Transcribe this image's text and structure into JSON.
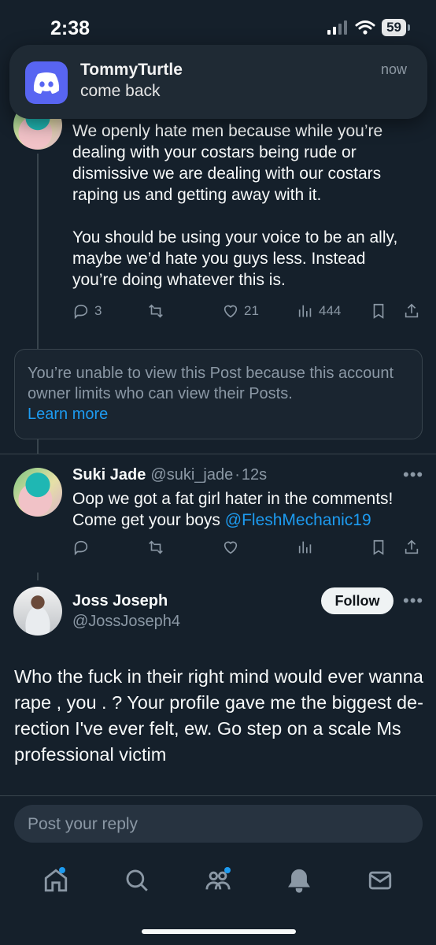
{
  "status_bar": {
    "time": "2:38",
    "battery": "59"
  },
  "notification": {
    "app_icon": "discord-icon",
    "title": "TommyTurtle",
    "body": "come back",
    "time": "now"
  },
  "tweet1": {
    "text_line1": "We openly hate men because while you’re",
    "text_line2": "dealing with your costars being rude or",
    "text_line3": "dismissive we are dealing with our costars",
    "text_line4": "raping us and getting away with it.",
    "text_line5": "You should be using your voice to be an ally,",
    "text_line6": "maybe we’d hate you guys less. Instead",
    "text_line7": "you’re doing whatever this is.",
    "replies": "3",
    "likes": "21",
    "views": "444"
  },
  "limited_notice": {
    "text": "You’re unable to view this Post because this account owner limits who can view their Posts.",
    "link": "Learn more"
  },
  "tweet2": {
    "name": "Suki Jade",
    "handle": "@suki_jade",
    "separator": "·",
    "time": "12s",
    "text_line1": "Oop we got a fat girl hater in the comments!",
    "text_line2_prefix": "Come get your boys ",
    "mention": "@FleshMechanic19"
  },
  "tweet3": {
    "name": "Joss Joseph",
    "handle": "@JossJoseph4",
    "follow_label": "Follow",
    "text": "Who the fuck in their right mind would ever wanna rape , you . ? Your profile gave me the biggest de-rection I've ever felt, ew. Go step on a scale Ms professional victim"
  },
  "reply_bar": {
    "placeholder": "Post your reply"
  },
  "tabbar": {
    "items": [
      "home-icon",
      "search-icon",
      "communities-icon",
      "notifications-icon",
      "messages-icon"
    ]
  },
  "colors": {
    "background": "#15202b",
    "accent": "#1d9bf0",
    "discord": "#5865f2"
  }
}
